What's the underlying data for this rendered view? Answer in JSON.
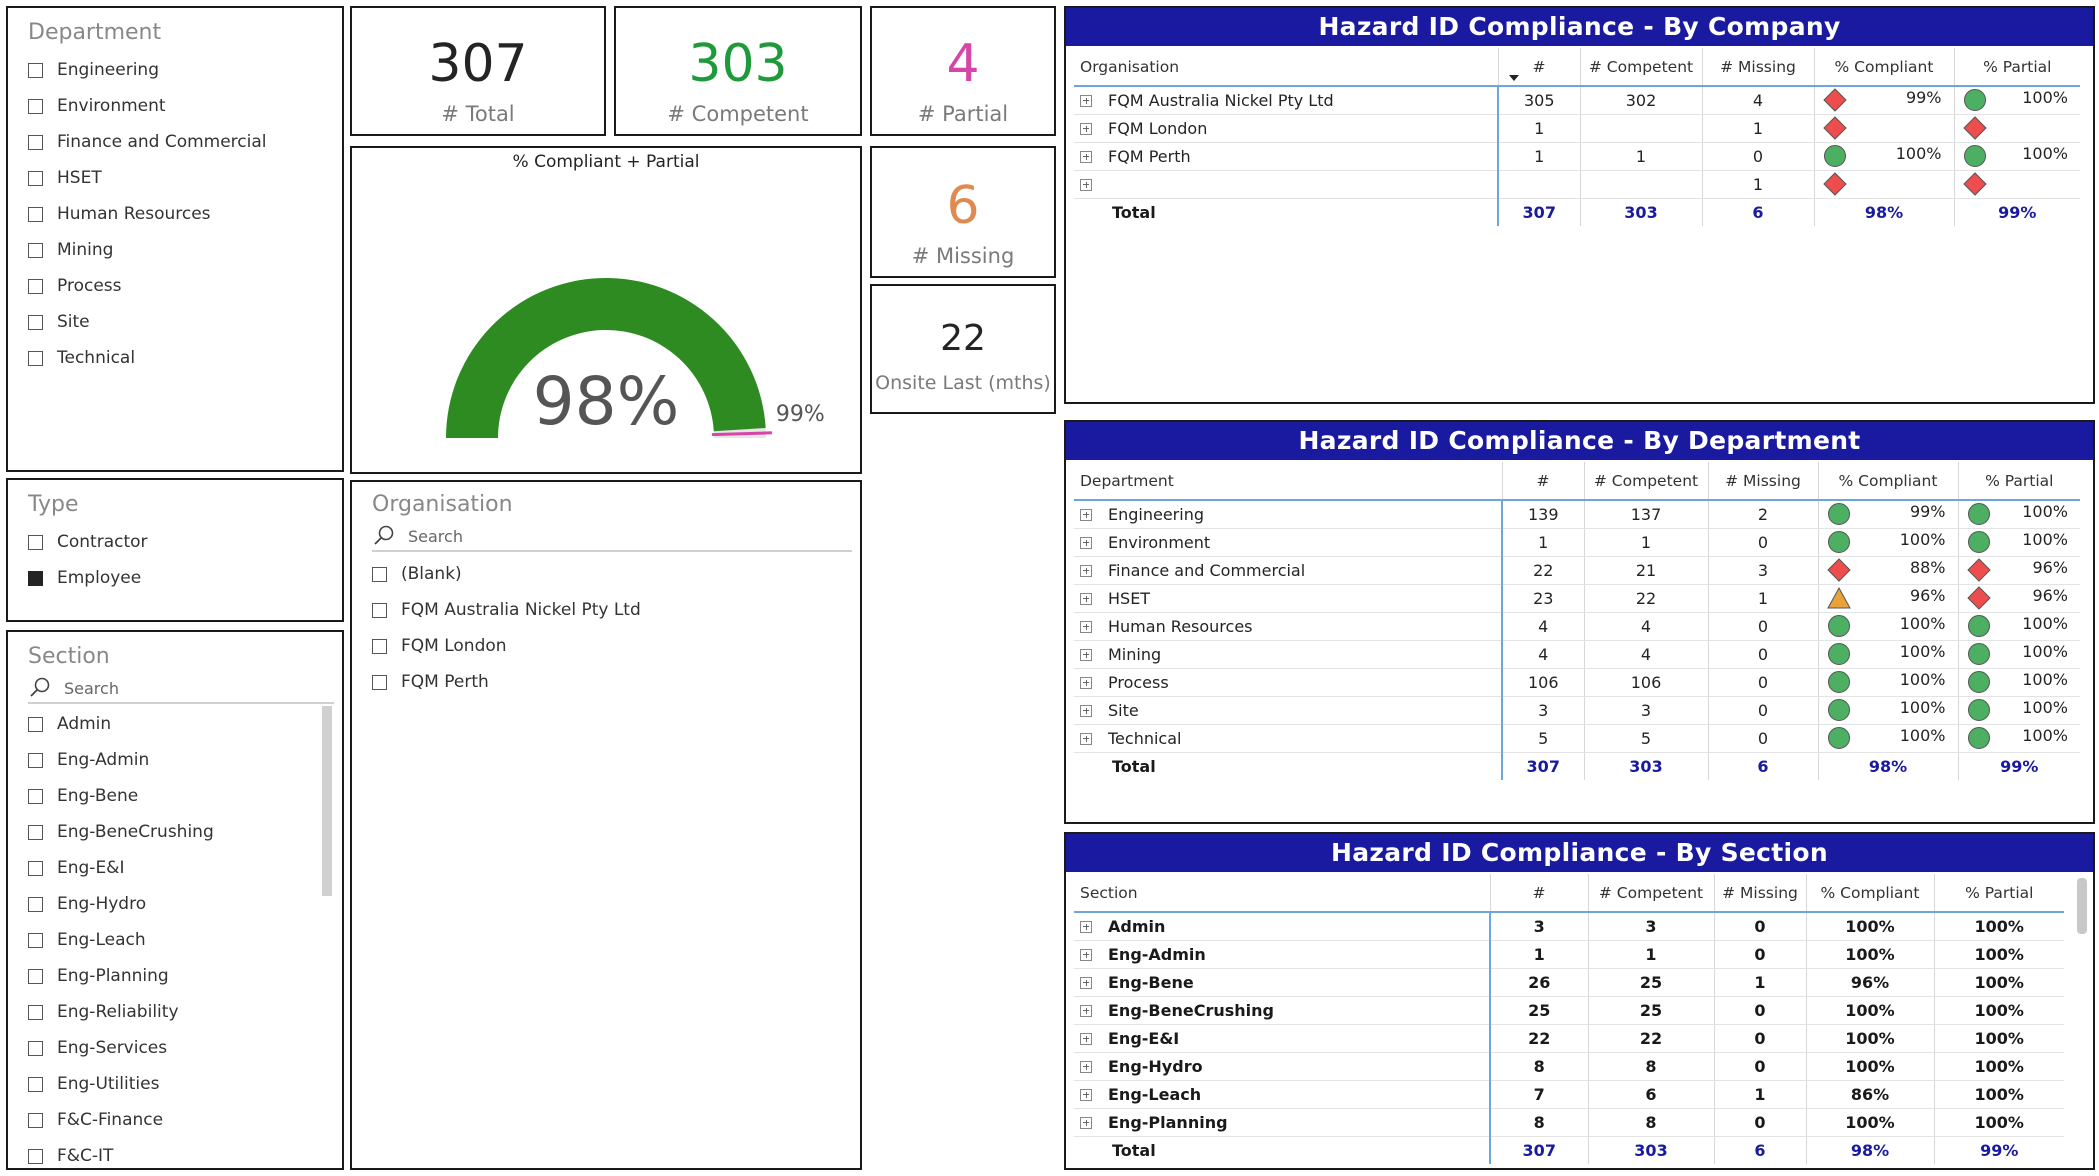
{
  "department_slicer": {
    "title": "Department",
    "items": [
      {
        "label": "Engineering",
        "checked": false
      },
      {
        "label": "Environment",
        "checked": false
      },
      {
        "label": "Finance and Commercial",
        "checked": false
      },
      {
        "label": "HSET",
        "checked": false
      },
      {
        "label": "Human Resources",
        "checked": false
      },
      {
        "label": "Mining",
        "checked": false
      },
      {
        "label": "Process",
        "checked": false
      },
      {
        "label": "Site",
        "checked": false
      },
      {
        "label": "Technical",
        "checked": false
      }
    ]
  },
  "type_slicer": {
    "title": "Type",
    "items": [
      {
        "label": "Contractor",
        "checked": false
      },
      {
        "label": "Employee",
        "checked": true
      }
    ]
  },
  "section_slicer": {
    "title": "Section",
    "search_placeholder": "Search",
    "items": [
      {
        "label": "Admin",
        "checked": false
      },
      {
        "label": "Eng-Admin",
        "checked": false
      },
      {
        "label": "Eng-Bene",
        "checked": false
      },
      {
        "label": "Eng-BeneCrushing",
        "checked": false
      },
      {
        "label": "Eng-E&I",
        "checked": false
      },
      {
        "label": "Eng-Hydro",
        "checked": false
      },
      {
        "label": "Eng-Leach",
        "checked": false
      },
      {
        "label": "Eng-Planning",
        "checked": false
      },
      {
        "label": "Eng-Reliability",
        "checked": false
      },
      {
        "label": "Eng-Services",
        "checked": false
      },
      {
        "label": "Eng-Utilities",
        "checked": false
      },
      {
        "label": "F&C-Finance",
        "checked": false
      },
      {
        "label": "F&C-IT",
        "checked": false
      }
    ]
  },
  "organisation_slicer": {
    "title": "Organisation",
    "search_placeholder": "Search",
    "items": [
      {
        "label": "(Blank)",
        "checked": false
      },
      {
        "label": "FQM Australia Nickel Pty Ltd",
        "checked": false
      },
      {
        "label": "FQM London",
        "checked": false
      },
      {
        "label": "FQM Perth",
        "checked": false
      }
    ]
  },
  "cards": {
    "total": {
      "value": "307",
      "label": "# Total",
      "color": "#252423"
    },
    "competent": {
      "value": "303",
      "label": "# Competent",
      "color": "#1f9a3a"
    },
    "partial": {
      "value": "4",
      "label": "# Partial",
      "color": "#d646a8"
    },
    "missing": {
      "value": "6",
      "label": "# Missing",
      "color": "#e08a50"
    },
    "onsite": {
      "value": "22",
      "label": "Onsite Last (mths)",
      "color": "#252423"
    }
  },
  "gauge": {
    "title": "% Compliant + Partial",
    "value_label": "98%",
    "target_label": "99%",
    "value": 98,
    "target": 99,
    "min": 0,
    "max": 100,
    "fill_color": "#2e8b22",
    "target_color": "#d646a8"
  },
  "colors": {
    "header_bg": "#1a1aa0",
    "good": "#4caf62",
    "bad": "#ee4d4d",
    "warn": "#e7a23a"
  },
  "company_table": {
    "title": "Hazard ID Compliance - By Company",
    "headers": [
      "Organisation",
      "#",
      "# Competent",
      "# Missing",
      "% Compliant",
      "% Partial"
    ],
    "rows": [
      {
        "name": "FQM Australia Nickel Pty Ltd",
        "count": "305",
        "competent": "302",
        "missing": "4",
        "compliant": "99%",
        "compliant_icon": "red-diamond-icon",
        "partial": "100%",
        "partial_icon": "green-circle-icon"
      },
      {
        "name": "FQM London",
        "count": "1",
        "competent": "",
        "missing": "1",
        "compliant": "",
        "compliant_icon": "red-diamond-icon",
        "partial": "",
        "partial_icon": "red-diamond-icon"
      },
      {
        "name": "FQM Perth",
        "count": "1",
        "competent": "1",
        "missing": "0",
        "compliant": "100%",
        "compliant_icon": "green-circle-icon",
        "partial": "100%",
        "partial_icon": "green-circle-icon"
      },
      {
        "name": "",
        "count": "",
        "competent": "",
        "missing": "1",
        "compliant": "",
        "compliant_icon": "red-diamond-icon",
        "partial": "",
        "partial_icon": "red-diamond-icon"
      }
    ],
    "total": {
      "label": "Total",
      "count": "307",
      "competent": "303",
      "missing": "6",
      "compliant": "98%",
      "partial": "99%"
    }
  },
  "department_table": {
    "title": "Hazard ID Compliance - By Department",
    "headers": [
      "Department",
      "#",
      "# Competent",
      "# Missing",
      "% Compliant",
      "% Partial"
    ],
    "rows": [
      {
        "name": "Engineering",
        "count": "139",
        "competent": "137",
        "missing": "2",
        "compliant": "99%",
        "compliant_icon": "green-circle-icon",
        "partial": "100%",
        "partial_icon": "green-circle-icon"
      },
      {
        "name": "Environment",
        "count": "1",
        "competent": "1",
        "missing": "0",
        "compliant": "100%",
        "compliant_icon": "green-circle-icon",
        "partial": "100%",
        "partial_icon": "green-circle-icon"
      },
      {
        "name": "Finance and Commercial",
        "count": "22",
        "competent": "21",
        "missing": "3",
        "compliant": "88%",
        "compliant_icon": "red-diamond-icon",
        "partial": "96%",
        "partial_icon": "red-diamond-icon"
      },
      {
        "name": "HSET",
        "count": "23",
        "competent": "22",
        "missing": "1",
        "compliant": "96%",
        "compliant_icon": "orange-triangle-icon",
        "partial": "96%",
        "partial_icon": "red-diamond-icon"
      },
      {
        "name": "Human Resources",
        "count": "4",
        "competent": "4",
        "missing": "0",
        "compliant": "100%",
        "compliant_icon": "green-circle-icon",
        "partial": "100%",
        "partial_icon": "green-circle-icon"
      },
      {
        "name": "Mining",
        "count": "4",
        "competent": "4",
        "missing": "0",
        "compliant": "100%",
        "compliant_icon": "green-circle-icon",
        "partial": "100%",
        "partial_icon": "green-circle-icon"
      },
      {
        "name": "Process",
        "count": "106",
        "competent": "106",
        "missing": "0",
        "compliant": "100%",
        "compliant_icon": "green-circle-icon",
        "partial": "100%",
        "partial_icon": "green-circle-icon"
      },
      {
        "name": "Site",
        "count": "3",
        "competent": "3",
        "missing": "0",
        "compliant": "100%",
        "compliant_icon": "green-circle-icon",
        "partial": "100%",
        "partial_icon": "green-circle-icon"
      },
      {
        "name": "Technical",
        "count": "5",
        "competent": "5",
        "missing": "0",
        "compliant": "100%",
        "compliant_icon": "green-circle-icon",
        "partial": "100%",
        "partial_icon": "green-circle-icon"
      }
    ],
    "total": {
      "label": "Total",
      "count": "307",
      "competent": "303",
      "missing": "6",
      "compliant": "98%",
      "partial": "99%"
    }
  },
  "section_table": {
    "title": "Hazard ID Compliance - By Section",
    "headers": [
      "Section",
      "#",
      "# Competent",
      "# Missing",
      "% Compliant",
      "% Partial"
    ],
    "rows": [
      {
        "name": "Admin",
        "count": "3",
        "competent": "3",
        "missing": "0",
        "compliant": "100%",
        "partial": "100%"
      },
      {
        "name": "Eng-Admin",
        "count": "1",
        "competent": "1",
        "missing": "0",
        "compliant": "100%",
        "partial": "100%"
      },
      {
        "name": "Eng-Bene",
        "count": "26",
        "competent": "25",
        "missing": "1",
        "compliant": "96%",
        "partial": "100%"
      },
      {
        "name": "Eng-BeneCrushing",
        "count": "25",
        "competent": "25",
        "missing": "0",
        "compliant": "100%",
        "partial": "100%"
      },
      {
        "name": "Eng-E&I",
        "count": "22",
        "competent": "22",
        "missing": "0",
        "compliant": "100%",
        "partial": "100%"
      },
      {
        "name": "Eng-Hydro",
        "count": "8",
        "competent": "8",
        "missing": "0",
        "compliant": "100%",
        "partial": "100%"
      },
      {
        "name": "Eng-Leach",
        "count": "7",
        "competent": "6",
        "missing": "1",
        "compliant": "86%",
        "partial": "100%"
      },
      {
        "name": "Eng-Planning",
        "count": "8",
        "competent": "8",
        "missing": "0",
        "compliant": "100%",
        "partial": "100%"
      }
    ],
    "total": {
      "label": "Total",
      "count": "307",
      "competent": "303",
      "missing": "6",
      "compliant": "98%",
      "partial": "99%"
    }
  }
}
